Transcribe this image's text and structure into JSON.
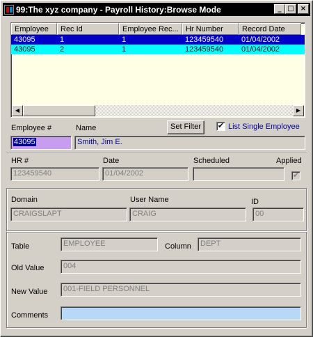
{
  "window": {
    "title": "99:The xyz company - Payroll History:Browse Mode",
    "minimize": "_",
    "maximize": "□",
    "close": "×"
  },
  "grid": {
    "columns": [
      "Employee",
      "Rec Id",
      "Employee Rec...",
      "Hr Number",
      "Record Date"
    ],
    "rows": [
      [
        "43095",
        "1",
        "1",
        "123459540",
        "01/04/2002"
      ],
      [
        "43095",
        "2",
        "1",
        "123459540",
        "01/04/2002"
      ]
    ],
    "scroll_left": "◀",
    "scroll_right": "▶"
  },
  "employee": {
    "number_label": "Employee #",
    "number_value": "43095",
    "name_label": "Name",
    "name_value": "Smith, Jim E."
  },
  "filter": {
    "set_filter_label": "Set Filter",
    "list_single_label": "List Single Employee",
    "list_single_checked": true
  },
  "record": {
    "hr_label": "HR #",
    "hr_value": "123459540",
    "date_label": "Date",
    "date_value": "01/04/2002",
    "scheduled_label": "Scheduled",
    "scheduled_value": "",
    "applied_label": "Applied",
    "applied_checked": true
  },
  "audit": {
    "domain_label": "Domain",
    "domain_value": "CRAIGSLAPT",
    "user_label": "User Name",
    "user_value": "CRAIG",
    "id_label": "ID",
    "id_value": "00"
  },
  "change": {
    "table_label": "Table",
    "table_value": "EMPLOYEE",
    "column_label": "Column",
    "column_value": "DEPT",
    "old_label": "Old Value",
    "old_value": "004",
    "new_label": "New Value",
    "new_value": "001-FIELD PERSONNEL",
    "comments_label": "Comments",
    "comments_value": ""
  },
  "colors": {
    "title_bar": "#000000",
    "selected_row": "#0000c8",
    "alt_row": "#00ffff",
    "employee_field": "#c89cf0",
    "comments_field": "#b8d8f8"
  }
}
